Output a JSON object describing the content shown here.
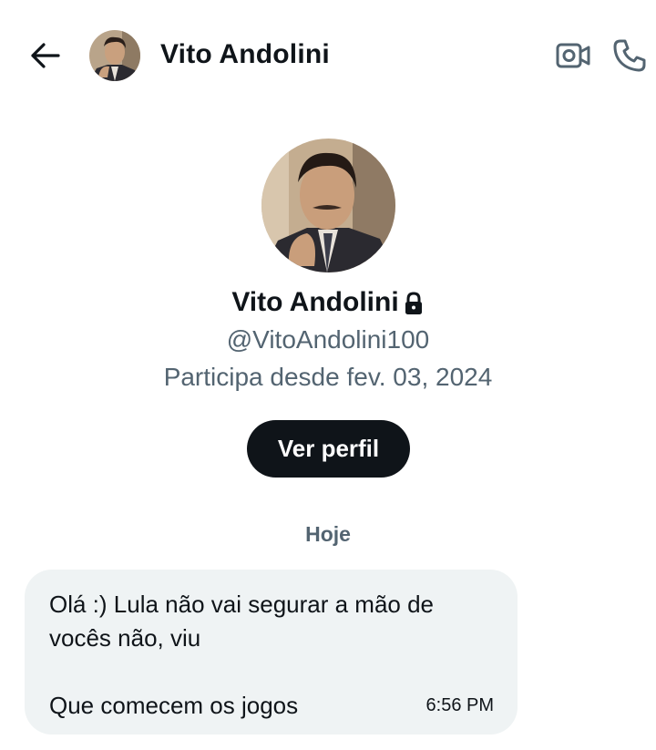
{
  "header": {
    "title": "Vito Andolini",
    "back_icon": "arrow-left-icon",
    "video_icon": "video-call-icon",
    "call_icon": "phone-icon"
  },
  "profile": {
    "name": "Vito Andolini",
    "protected_icon": "lock-icon",
    "handle": "@VitoAndolini100",
    "joined": "Participa desde fev. 03, 2024",
    "view_profile_label": "Ver perfil"
  },
  "conversation": {
    "date_divider": "Hoje",
    "messages": [
      {
        "text": "Olá :) Lula não vai segurar a mão de\nvocês não, viu\n\nQue comecem os jogos",
        "time": "6:56 PM"
      }
    ]
  },
  "colors": {
    "text_primary": "#0f1419",
    "text_secondary": "#536471",
    "bubble_bg": "#eff3f4",
    "button_bg": "#0f1419"
  }
}
